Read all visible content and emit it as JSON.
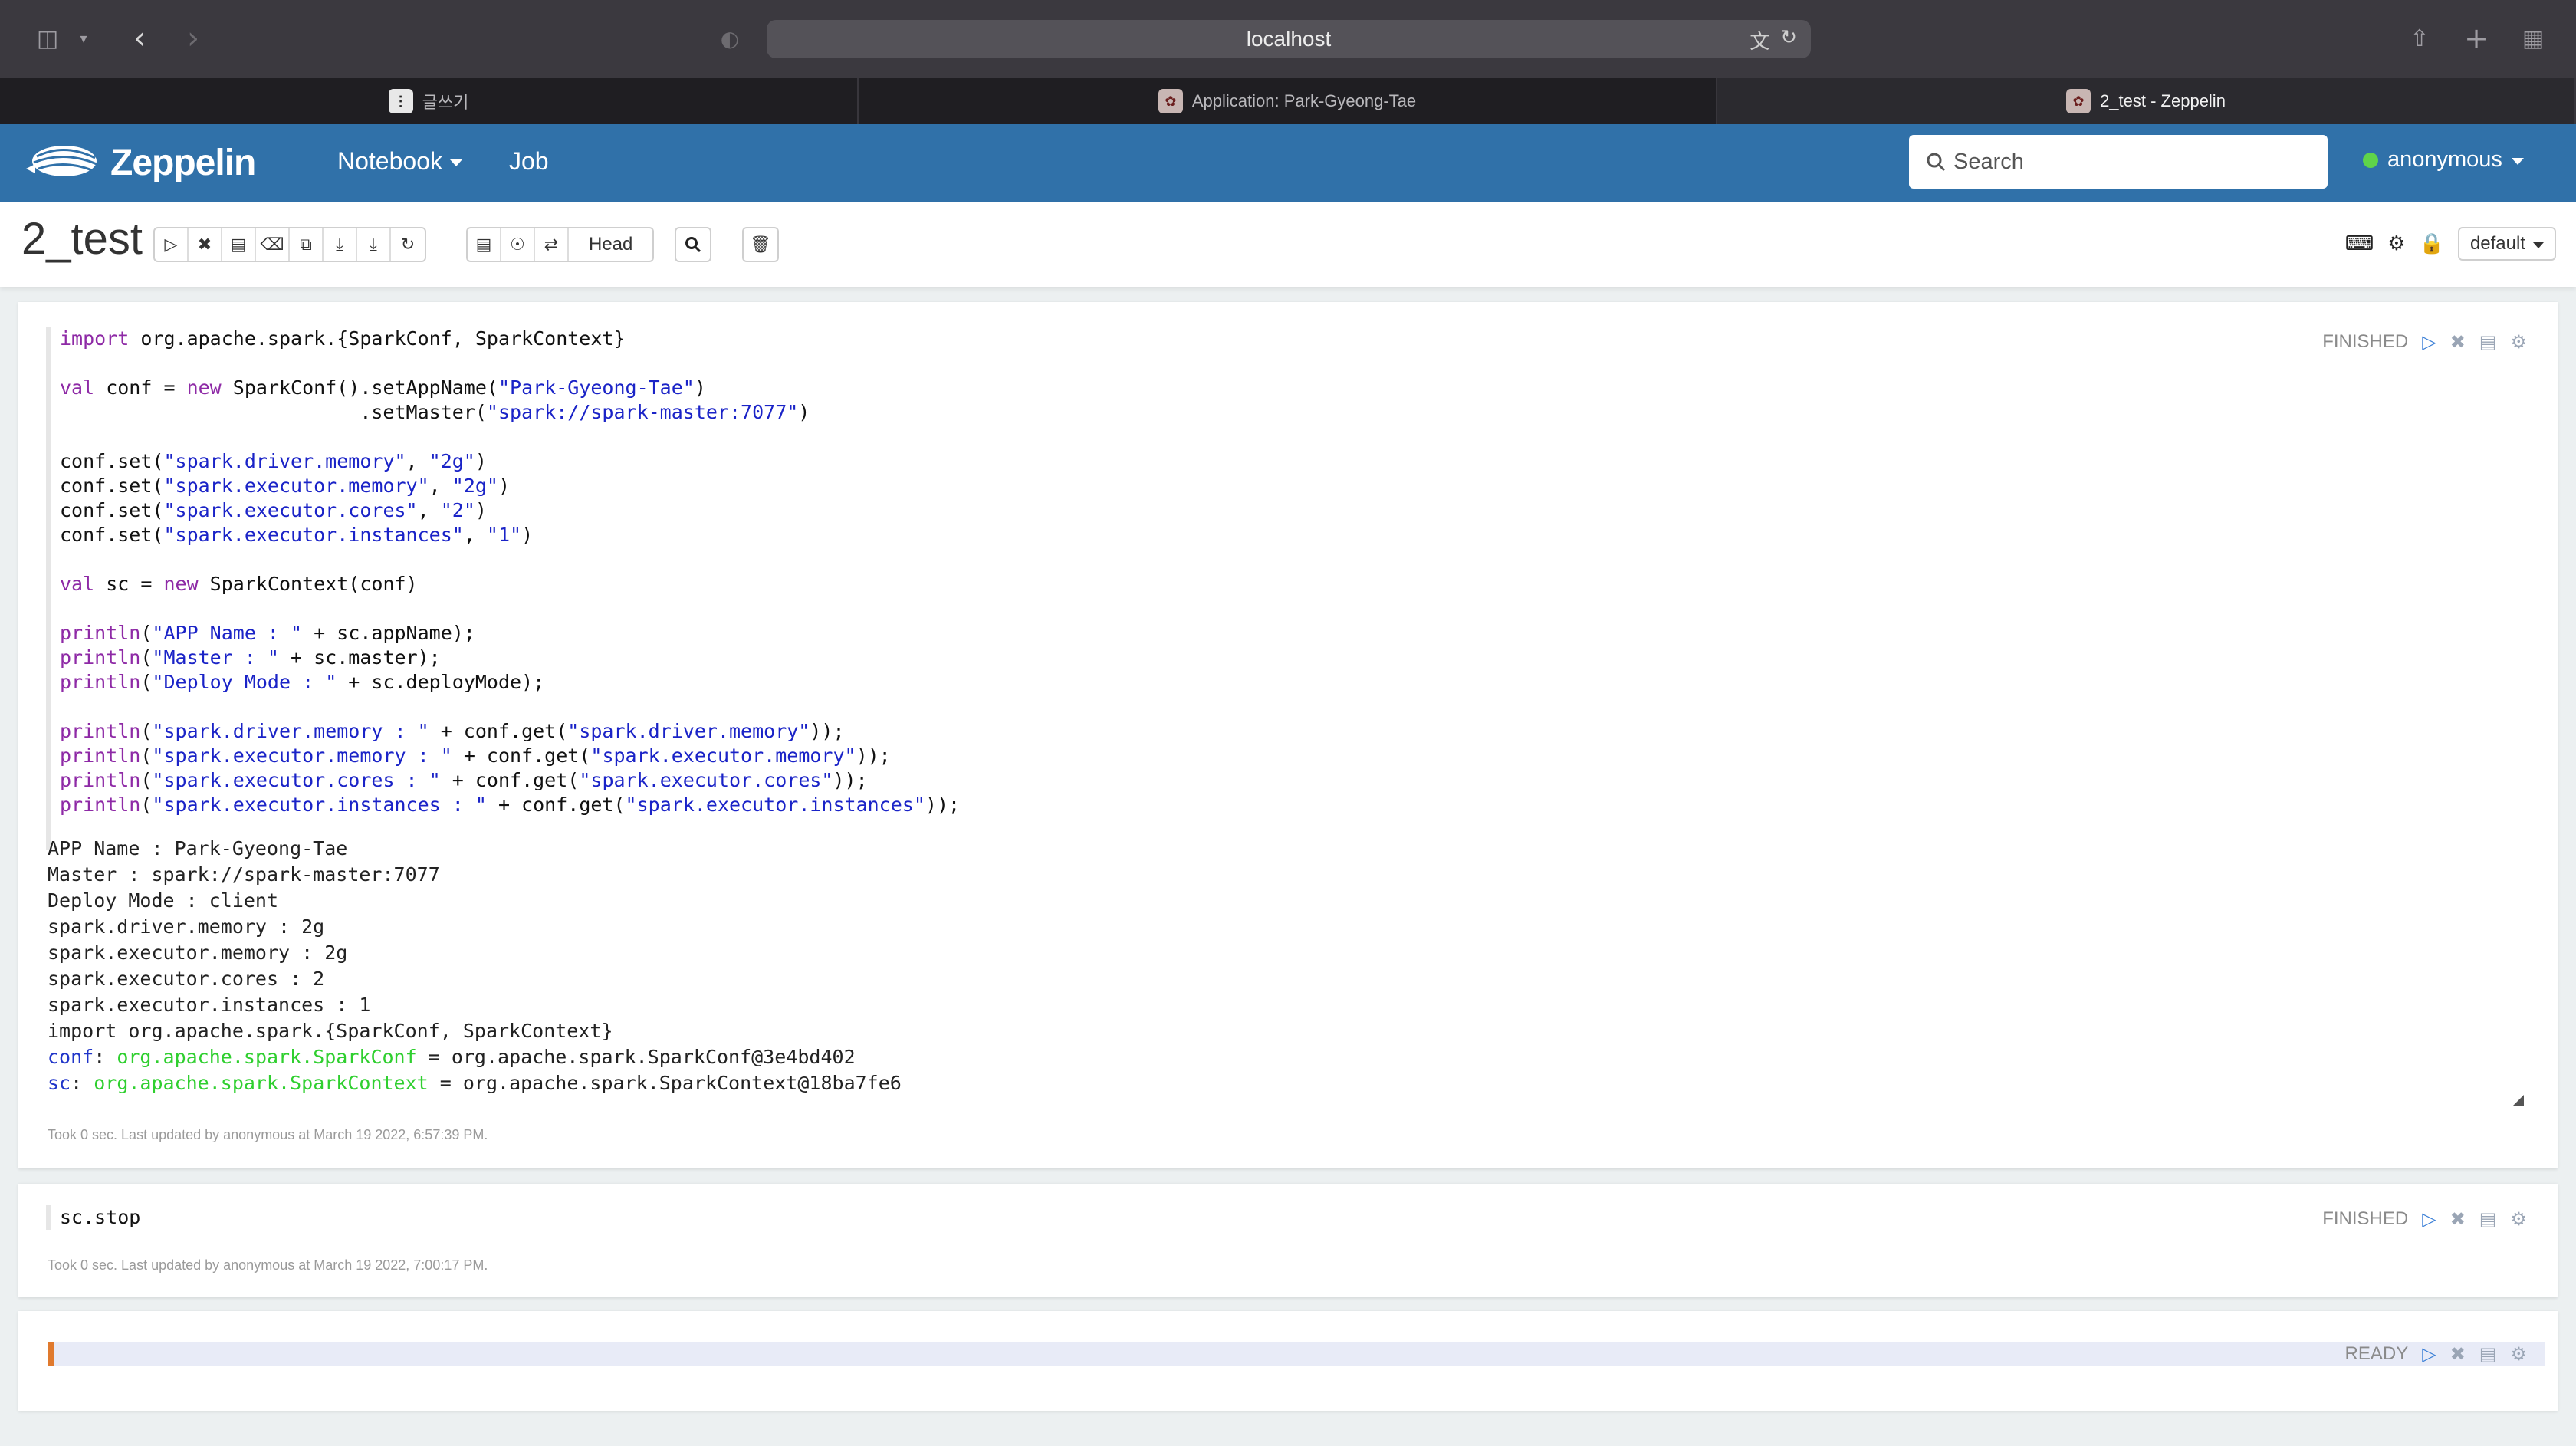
{
  "browser": {
    "url": "localhost",
    "tabs": [
      {
        "title": "글쓰기",
        "icon": "notes-icon",
        "active": false
      },
      {
        "title": "Application: Park-Gyeong-Tae",
        "icon": "spark-app-icon",
        "active": false
      },
      {
        "title": "2_test - Zeppelin",
        "icon": "zeppelin-tab-icon",
        "active": true
      }
    ]
  },
  "navbar": {
    "brand": "Zeppelin",
    "menu_notebook": "Notebook",
    "menu_job": "Job",
    "search_placeholder": "Search",
    "user": "anonymous"
  },
  "notebook": {
    "title": "2_test",
    "head_label": "Head",
    "interpreter_binding": "default"
  },
  "paragraphs": [
    {
      "status": "FINISHED",
      "code": [
        "import org.apache.spark.{SparkConf, SparkContext}",
        "",
        "val conf = new SparkConf().setAppName(\"Park-Gyeong-Tae\")",
        "                          .setMaster(\"spark://spark-master:7077\")",
        "",
        "conf.set(\"spark.driver.memory\", \"2g\")",
        "conf.set(\"spark.executor.memory\", \"2g\")",
        "conf.set(\"spark.executor.cores\", \"2\")",
        "conf.set(\"spark.executor.instances\", \"1\")",
        "",
        "val sc = new SparkContext(conf)",
        "",
        "println(\"APP Name : \" + sc.appName);",
        "println(\"Master : \" + sc.master);",
        "println(\"Deploy Mode : \" + sc.deployMode);",
        "",
        "println(\"spark.driver.memory : \" + conf.get(\"spark.driver.memory\"));",
        "println(\"spark.executor.memory : \" + conf.get(\"spark.executor.memory\"));",
        "println(\"spark.executor.cores : \" + conf.get(\"spark.executor.cores\"));",
        "println(\"spark.executor.instances : \" + conf.get(\"spark.executor.instances\"));"
      ],
      "output": [
        "APP Name : Park-Gyeong-Tae",
        "Master : spark://spark-master:7077",
        "Deploy Mode : client",
        "spark.driver.memory : 2g",
        "spark.executor.memory : 2g",
        "spark.executor.cores : 2",
        "spark.executor.instances : 1",
        "import org.apache.spark.{SparkConf, SparkContext}"
      ],
      "typed_output": [
        {
          "name": "conf",
          "type": "org.apache.spark.SparkConf",
          "value": " = org.apache.spark.SparkConf@3e4bd402"
        },
        {
          "name": "sc",
          "type": "org.apache.spark.SparkContext",
          "value": " = org.apache.spark.SparkContext@18ba7fe6"
        }
      ],
      "footer": "Took 0 sec. Last updated by anonymous at March 19 2022, 6:57:39 PM."
    },
    {
      "status": "FINISHED",
      "code": [
        "sc.stop"
      ],
      "footer": "Took 0 sec. Last updated by anonymous at March 19 2022, 7:00:17 PM."
    },
    {
      "status": "READY",
      "code": [],
      "footer": ""
    }
  ],
  "colors": {
    "navbar": "#3071a9",
    "keyword": "#8e2aa6",
    "string": "#1a23c7",
    "output_type": "#2fcf2f",
    "output_name": "#2035c9",
    "cursor": "#e07a2e"
  }
}
